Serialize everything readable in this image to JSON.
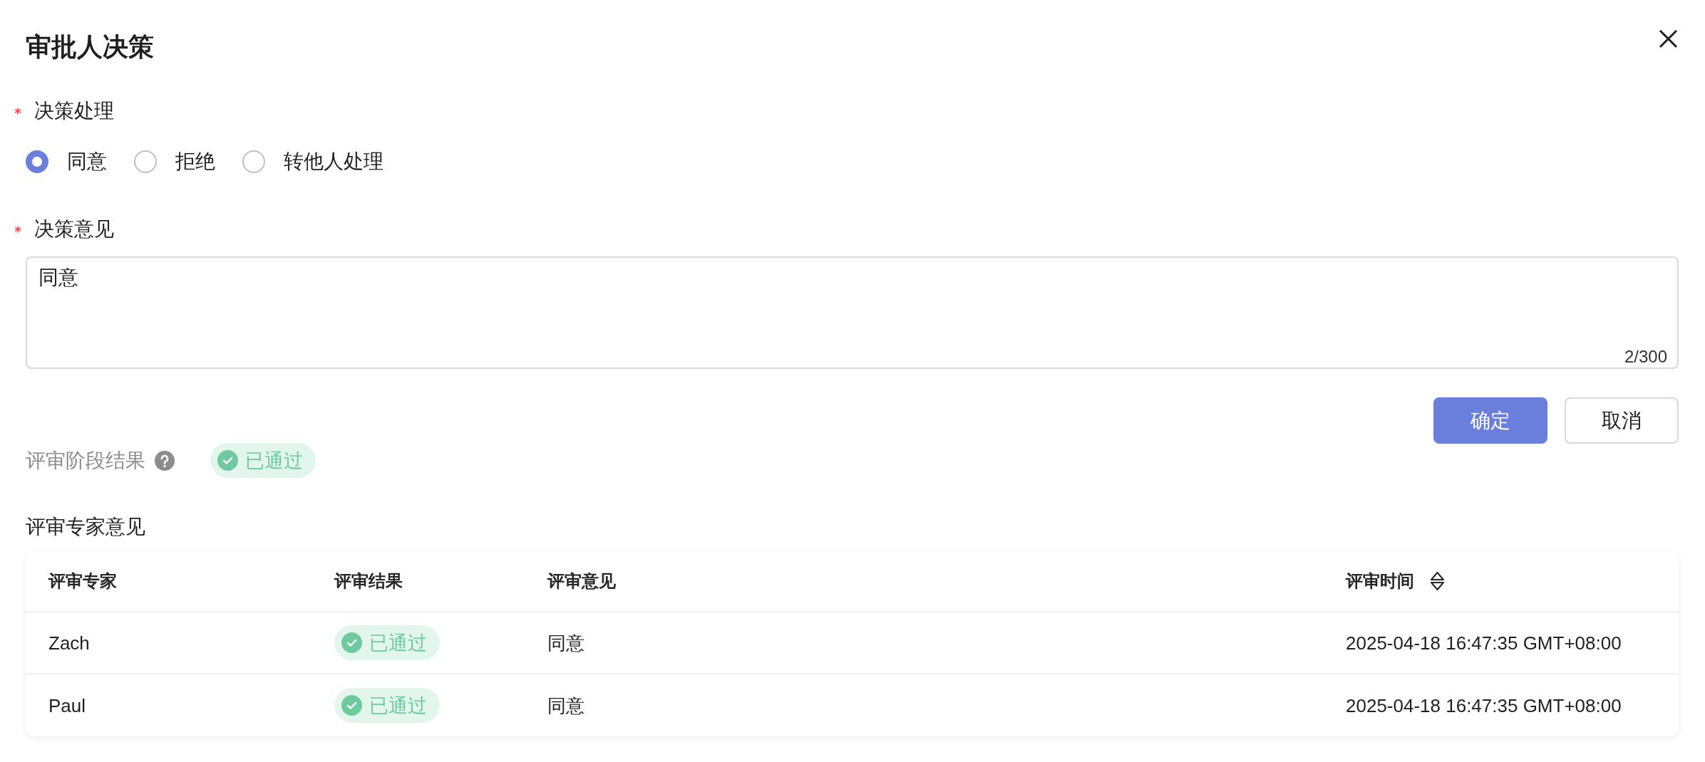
{
  "dialog": {
    "title": "审批人决策"
  },
  "decision": {
    "label": "决策处理",
    "required": true,
    "options": [
      {
        "label": "同意",
        "selected": true
      },
      {
        "label": "拒绝",
        "selected": false
      },
      {
        "label": "转他人处理",
        "selected": false
      }
    ]
  },
  "opinion": {
    "label": "决策意见",
    "required": true,
    "value": "同意",
    "counter": "2/300"
  },
  "buttons": [
    {
      "label": "确定",
      "kind": "primary"
    },
    {
      "label": "取消",
      "kind": "default"
    }
  ],
  "stage_result": {
    "label": "评审阶段结果",
    "status": "已通过"
  },
  "expert_opinions": {
    "title": "评审专家意见",
    "table": {
      "columns": [
        {
          "label": "评审专家",
          "kind": "text",
          "sortable": false
        },
        {
          "label": "评审结果",
          "kind": "status",
          "sortable": false
        },
        {
          "label": "评审意见",
          "kind": "text",
          "sortable": false
        },
        {
          "label": "评审时间",
          "kind": "text",
          "sortable": true
        }
      ],
      "rows": [
        {
          "cells": [
            "Zach",
            "已通过",
            "同意",
            "2025-04-18 16:47:35 GMT+08:00"
          ]
        },
        {
          "cells": [
            "Paul",
            "已通过",
            "同意",
            "2025-04-18 16:47:35 GMT+08:00"
          ]
        }
      ]
    }
  }
}
